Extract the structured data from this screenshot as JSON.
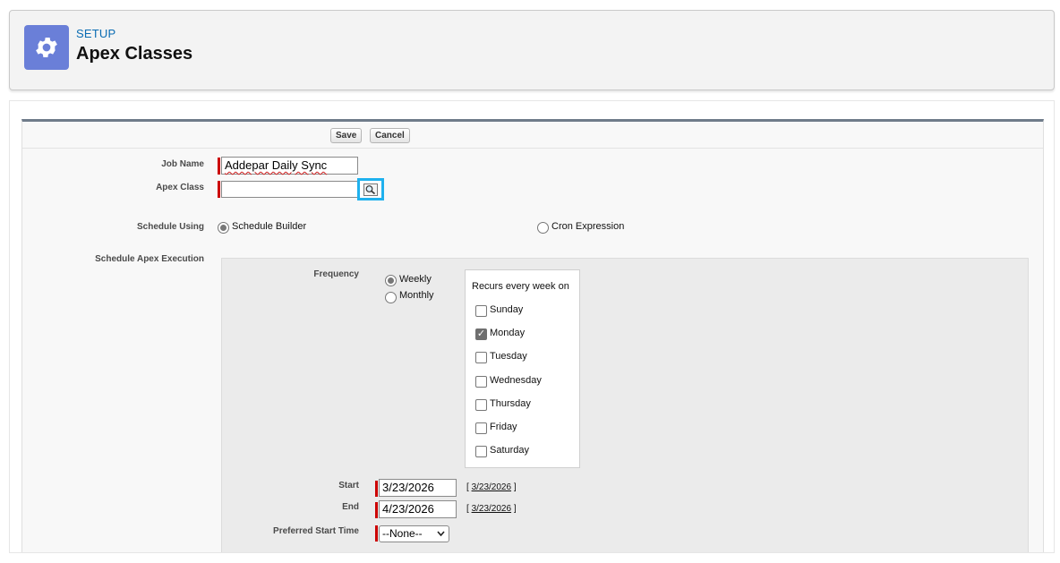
{
  "header": {
    "eyebrow": "SETUP",
    "title": "Apex Classes",
    "icon": "gear-icon",
    "icon_bg": "#6a7fd8"
  },
  "buttons": {
    "save": "Save",
    "cancel": "Cancel"
  },
  "form": {
    "job_name_label": "Job Name",
    "job_name_value": "Addepar Daily Sync",
    "apex_class_label": "Apex Class",
    "apex_class_value": "",
    "lookup_icon": "magnifier-icon",
    "schedule_using_label": "Schedule Using",
    "schedule_builder": "Schedule Builder",
    "cron_expression": "Cron Expression",
    "schedule_using_selected": "Schedule Builder",
    "schedule_apex_label": "Schedule Apex Execution",
    "frequency_label": "Frequency",
    "frequency_options": [
      "Weekly",
      "Monthly"
    ],
    "frequency_selected": "Weekly",
    "recurs_title": "Recurs every week on",
    "days": [
      {
        "label": "Sunday",
        "checked": false
      },
      {
        "label": "Monday",
        "checked": true
      },
      {
        "label": "Tuesday",
        "checked": false
      },
      {
        "label": "Wednesday",
        "checked": false
      },
      {
        "label": "Thursday",
        "checked": false
      },
      {
        "label": "Friday",
        "checked": false
      },
      {
        "label": "Saturday",
        "checked": false
      }
    ],
    "start_label": "Start",
    "start_value": "3/23/2026",
    "start_today": "3/23/2026",
    "end_label": "End",
    "end_value": "4/23/2026",
    "end_today": "3/23/2026",
    "preferred_label": "Preferred Start Time",
    "preferred_value": "--None--"
  },
  "colors": {
    "accent_link": "#0a6cb3",
    "required": "#cc0000",
    "focus_ring": "#1fb1ee"
  }
}
